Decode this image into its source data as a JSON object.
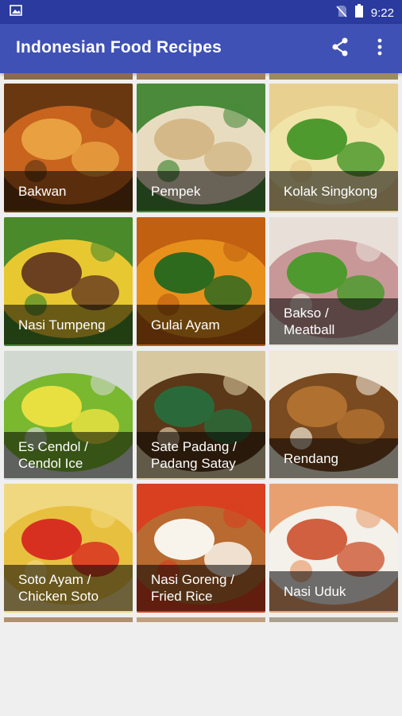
{
  "status_bar": {
    "time": "9:22"
  },
  "app_bar": {
    "title": "Indonesian Food Recipes"
  },
  "colors": {
    "primary": "#3f51b5",
    "primary_dark": "#2a3a9e",
    "background": "#efefef"
  },
  "icons": {
    "share": "share-icon",
    "overflow": "more-vert-icon"
  },
  "recipes": [
    {
      "name": "Bakwan",
      "palette": [
        "#c8641e",
        "#e8a040",
        "#6a3810"
      ]
    },
    {
      "name": "Pempek",
      "palette": [
        "#e8dcc0",
        "#d4b888",
        "#4a8a3a"
      ]
    },
    {
      "name": "Kolak Singkong",
      "palette": [
        "#f0e4a8",
        "#4e9a2e",
        "#e8d090"
      ]
    },
    {
      "name": "Nasi Tumpeng",
      "palette": [
        "#e8c830",
        "#6a4020",
        "#4a8a2a"
      ]
    },
    {
      "name": "Gulai Ayam",
      "palette": [
        "#e8901c",
        "#2e6a1e",
        "#c06010"
      ]
    },
    {
      "name": "Bakso /\nMeatball",
      "palette": [
        "#c89898",
        "#4e9a2e",
        "#e8e0d8"
      ]
    },
    {
      "name": "Es Cendol /\nCendol Ice",
      "palette": [
        "#7ab830",
        "#e8e040",
        "#d0d8d0"
      ]
    },
    {
      "name": "Sate Padang /\nPadang Satay",
      "palette": [
        "#5a3818",
        "#2a6a3a",
        "#d8c8a0"
      ]
    },
    {
      "name": "Rendang",
      "palette": [
        "#7a4a20",
        "#b07030",
        "#f0e8d8"
      ]
    },
    {
      "name": "Soto Ayam /\nChicken Soto",
      "palette": [
        "#e8c040",
        "#d83020",
        "#f0d880"
      ]
    },
    {
      "name": "Nasi Goreng /\nFried Rice",
      "palette": [
        "#b86a30",
        "#f8f4ec",
        "#d84020"
      ]
    },
    {
      "name": "Nasi Uduk",
      "palette": [
        "#f4f0ea",
        "#d06040",
        "#e8a070"
      ]
    }
  ]
}
